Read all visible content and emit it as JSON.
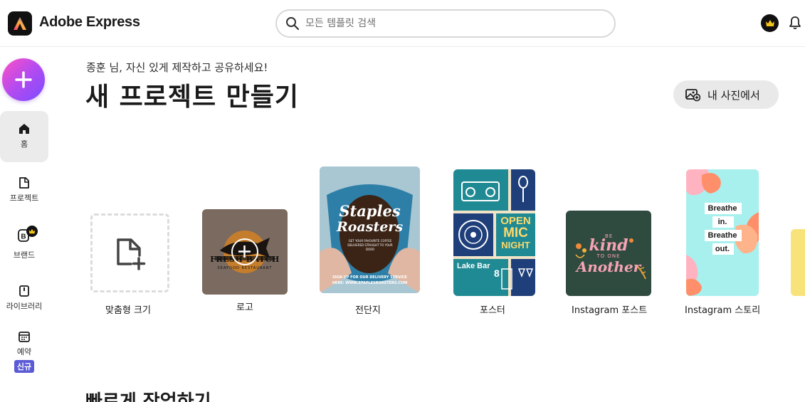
{
  "header": {
    "brand_name": "Adobe Express",
    "search_placeholder": "모든 템플릿 검색",
    "icons": [
      "adobe-express-logo-icon",
      "search-icon",
      "crown-icon",
      "bell-icon"
    ]
  },
  "sidebar": {
    "create_icon": "plus-icon",
    "items": [
      {
        "label": "홈",
        "icon": "home-icon"
      },
      {
        "label": "프로젝트",
        "icon": "file-icon"
      },
      {
        "label": "브랜드",
        "icon": "brand-icon"
      },
      {
        "label": "라이브러리",
        "icon": "library-icon"
      },
      {
        "label": "예약",
        "icon": "calendar-icon",
        "badge": "신규"
      }
    ]
  },
  "main": {
    "greeting": "종훈 님, 자신 있게 제작하고 공유하세요!",
    "title": "새 프로젝트 만들기",
    "from_photo_label": "내 사진에서",
    "cards": [
      {
        "label": "맞춤형 크기"
      },
      {
        "label": "로고",
        "thumb_text": "FRESH BATCH",
        "thumb_sub": "SEAFOOD RESTAURANT"
      },
      {
        "label": "전단지",
        "thumb_title_1": "Staples",
        "thumb_title_2": "Roasters",
        "thumb_fine": "GET YOUR FAVOURITE COFFEE DELIVERED STRAIGHT TO YOUR DOOR",
        "thumb_cta": "SIGN UP FOR OUR DELIVERY SERVICE HERE: WWW.STAPLESROASTERS.COM"
      },
      {
        "label": "포스터",
        "thumb_line_1": "OPEN",
        "thumb_line_2": "MIC",
        "thumb_line_3": "NIGHT",
        "thumb_venue": "Lake Bar",
        "thumb_num": "8"
      },
      {
        "label": "Instagram 포스트",
        "thumb_be": "BE",
        "thumb_kind": "kind",
        "thumb_to": "TO ONE",
        "thumb_another": "Another"
      },
      {
        "label": "Instagram 스토리",
        "thumb_l1": "Breathe",
        "thumb_l2": "in.",
        "thumb_l3": "Breathe",
        "thumb_l4": "out."
      }
    ],
    "next_section_title": "빠르게 작업하기"
  },
  "colors": {
    "accent_gradient_start": "#ff4fc4",
    "accent_gradient_end": "#7a4cff",
    "new_badge": "#5b5bd6",
    "poster_teal": "#1f8a93",
    "poster_navy": "#1f3f7a",
    "insta_green": "#2f4a3e",
    "story_cyan": "#a8f0ee"
  }
}
